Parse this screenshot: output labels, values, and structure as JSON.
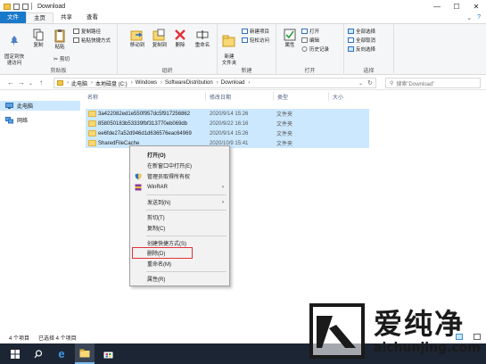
{
  "window": {
    "title": "Download",
    "controls": {
      "minimize": "—",
      "maximize": "☐",
      "close": "✕"
    }
  },
  "ribbon_tabs": [
    "文件",
    "主页",
    "共享",
    "查看"
  ],
  "ribbon": {
    "clipboard": {
      "label": "剪贴板",
      "pin": "固定到快\n速访问",
      "copy": "复制",
      "paste": "粘贴",
      "copy_path": "复制路径",
      "paste_shortcut": "粘贴快捷方式",
      "cut": "剪切"
    },
    "organize": {
      "label": "组织",
      "move_to": "移动到",
      "copy_to": "复制到",
      "delete": "删除",
      "rename": "重命名"
    },
    "new": {
      "label": "新建",
      "new_folder": "新建\n文件夹",
      "new_item": "新建项目",
      "easy_access": "轻松访问"
    },
    "open": {
      "label": "打开",
      "properties": "属性",
      "open": "打开",
      "edit": "编辑",
      "history": "历史记录"
    },
    "select": {
      "label": "选择",
      "select_all": "全部选择",
      "select_none": "全部取消",
      "invert": "反向选择"
    }
  },
  "address": {
    "crumbs": [
      "此电脑",
      "本地磁盘 (C:)",
      "Windows",
      "SoftwareDistribution",
      "Download"
    ],
    "search_placeholder": "搜索\"Download\""
  },
  "nav_pane": {
    "items": [
      {
        "label": "此电脑",
        "selected": true
      },
      {
        "label": "网络",
        "selected": false
      }
    ]
  },
  "columns": [
    "名称",
    "修改日期",
    "类型",
    "大小"
  ],
  "files": [
    {
      "name": "3a422082ed1e550f957dc5f917256862",
      "date": "2020/9/14 15:26",
      "type": "文件夹"
    },
    {
      "name": "858050183b53339fbf313770eb069db",
      "date": "2020/9/22 16:16",
      "type": "文件夹"
    },
    {
      "name": "ee6fde27a52d946d1d636576eac64969",
      "date": "2020/9/14 15:26",
      "type": "文件夹"
    },
    {
      "name": "SharedFileCache",
      "date": "2020/10/9 15:41",
      "type": "文件夹"
    }
  ],
  "context_menu": {
    "items": [
      {
        "label": "打开(O)",
        "bold": true
      },
      {
        "label": "在新窗口中打开(E)"
      },
      {
        "label": "管理员取得所有权"
      },
      {
        "label": "WinRAR",
        "submenu": true
      },
      {
        "label": "发送到(N)",
        "submenu": true
      },
      {
        "label": "剪切(T)"
      },
      {
        "label": "复制(C)"
      },
      {
        "label": "创建快捷方式(S)"
      },
      {
        "label": "删除(D)",
        "highlighted": true
      },
      {
        "label": "重命名(M)"
      },
      {
        "label": "属性(R)"
      }
    ]
  },
  "status": {
    "item_count": "4 个项目",
    "selected_count": "已选择 4 个项目"
  },
  "watermark": {
    "chinese": "爱纯净",
    "url": "aichunjing.com"
  },
  "colors": {
    "file_tab": "#1979ca",
    "selection": "#cce8ff",
    "highlight_box": "#e2323a",
    "taskbar": "#1c2533"
  }
}
